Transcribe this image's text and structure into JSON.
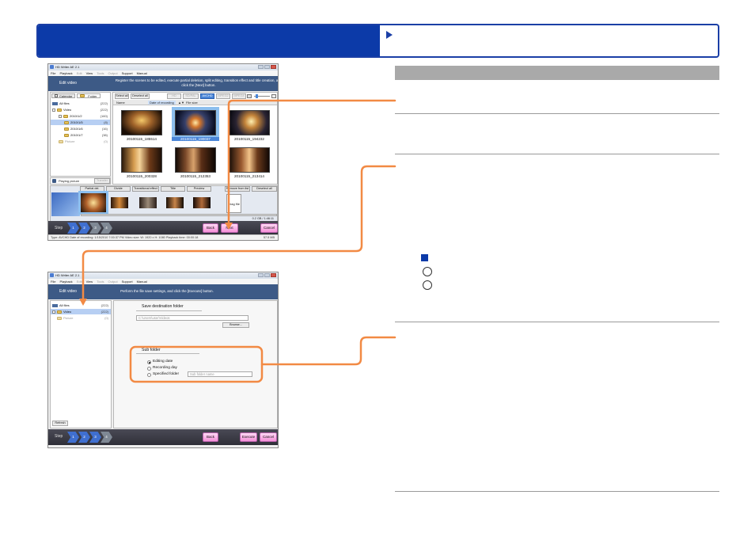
{
  "window1": {
    "title": "HD Writer AE 2.1",
    "menu": [
      "File",
      "Playback",
      "Edit",
      "View",
      "Tools",
      "Output",
      "Support",
      "Manual"
    ],
    "menu_dim": [
      false,
      false,
      true,
      false,
      true,
      true,
      false,
      false
    ],
    "banner_title": "Edit video",
    "banner_desc": "Register the scenes to be edited, execute partial deletion, split editing, transition effect and title creation, and click the [Next] button.",
    "tabs": [
      "Calendar",
      "Folder"
    ],
    "tree": [
      {
        "label": "All files",
        "count": "(222)"
      },
      {
        "label": "Video",
        "count": "(222)"
      },
      {
        "label": "2010/1/2",
        "count": "(160)"
      },
      {
        "label": "2010/1/5",
        "count": "(8)"
      },
      {
        "label": "2010/1/6",
        "count": "(16)"
      },
      {
        "label": "2010/1/7",
        "count": "(38)"
      },
      {
        "label": "Picture",
        "count": "(0)"
      }
    ],
    "toolbar": [
      "Select all",
      "Deselect all"
    ],
    "format_buttons": [
      "HD",
      "SD/PAL",
      "AVCHD",
      "MPEG2",
      "MPEG4"
    ],
    "col_name": "Name",
    "sort_label": "Date of recording",
    "sort_label2": "File size",
    "thumbnails": [
      "20100115_185514",
      "20100115_190037",
      "20100115_194232",
      "20100115_200328",
      "20100115_212353",
      "20100115_213414"
    ],
    "playing_label": "Playing picture",
    "playing_btn": "Transfer",
    "strip_buttons": [
      "Partial del.",
      "Divide",
      "Transitional effect",
      "Title",
      "Preview",
      "Remove from list",
      "Deselect all"
    ],
    "strip_endlabel": "Drag file",
    "strip_size": "0.2 GB / 1:46:11",
    "step_label": "Step",
    "steps": [
      "1",
      "2",
      "3",
      "4"
    ],
    "back": "Back",
    "next": "Next",
    "cancel": "Cancel",
    "status_left": "Type: AVCHD   Date of recording: 1/15/2010 7:00:37 PM   Video size: W: 1920 x H: 1080  Playback time: 00:00:18",
    "status_right": "57.5 MB"
  },
  "window2": {
    "title": "HD Writer AE 2.1",
    "menu": [
      "File",
      "Playback",
      "Edit",
      "View",
      "Tools",
      "Output",
      "Support",
      "Manual"
    ],
    "menu_dim": [
      false,
      false,
      true,
      false,
      true,
      true,
      false,
      false
    ],
    "banner_title": "Edit video",
    "banner_desc": "Perform the file save settings, and click the [Execute] button.",
    "tree": [
      {
        "label": "All files",
        "count": "(222)"
      },
      {
        "label": "Video",
        "count": "(222)"
      },
      {
        "label": "Picture",
        "count": "(0)"
      }
    ],
    "refresh": "Refresh",
    "save_dest_label": "Save destination folder",
    "save_dest_path": "C:\\Users\\user\\Videos",
    "browse": "Browse...",
    "sub_folder_label": "Sub folder",
    "radio_options": [
      "Editing date",
      "Recording day",
      "Specified folder"
    ],
    "sub_folder_placeholder": "Sub folder name",
    "step_label": "Step",
    "steps": [
      "1",
      "2",
      "3",
      "4"
    ],
    "back": "Back",
    "execute": "Execute",
    "cancel": "Cancel"
  },
  "colors": {
    "header_blue": "#0c3aa8",
    "connector_orange": "#f28a44",
    "pink_button": "#f58fd8",
    "highlight_row": "#b7cff3"
  }
}
